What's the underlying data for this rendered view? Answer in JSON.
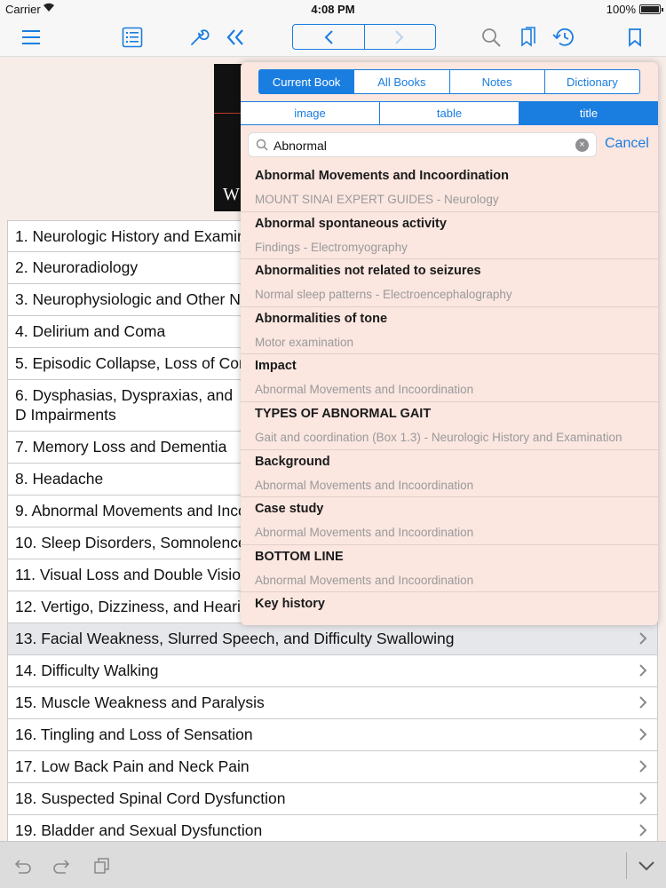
{
  "status_bar": {
    "carrier": "Carrier",
    "time": "4:08 PM",
    "battery": "100%"
  },
  "toolbar": {
    "icons": [
      "menu-icon",
      "list-icon",
      "wrench-icon",
      "double-chevron-left-icon",
      "back-icon",
      "forward-icon",
      "search-icon",
      "bookmarks-icon",
      "history-icon",
      "bookmark-icon"
    ],
    "accent": "#1a7de0"
  },
  "cover": {
    "visible_letter": "W"
  },
  "toc": {
    "items": [
      {
        "label": "1. Neurologic History and Examir"
      },
      {
        "label": "2. Neuroradiology"
      },
      {
        "label": "3. Neurophysiologic and Other N"
      },
      {
        "label": "4. Delirium and Coma"
      },
      {
        "label": "5. Episodic Collapse, Loss of Cor"
      },
      {
        "label": "6. Dysphasias, Dyspraxias, and D Impairments"
      },
      {
        "label": "7. Memory Loss and Dementia"
      },
      {
        "label": "8. Headache"
      },
      {
        "label": "9. Abnormal Movements and Inco"
      },
      {
        "label": "10. Sleep Disorders, Somnolence"
      },
      {
        "label": "11. Visual Loss and Double Visio"
      },
      {
        "label": "12. Vertigo, Dizziness, and Heari"
      },
      {
        "label": "13. Facial Weakness, Slurred Speech, and Difficulty Swallowing"
      },
      {
        "label": "14. Difficulty Walking"
      },
      {
        "label": "15. Muscle Weakness and Paralysis"
      },
      {
        "label": "16. Tingling and Loss of Sensation"
      },
      {
        "label": "17. Low Back Pain and Neck Pain"
      },
      {
        "label": "18. Suspected Spinal Cord Dysfunction"
      },
      {
        "label": "19. Bladder and Sexual Dysfunction"
      }
    ]
  },
  "search": {
    "scope_tabs": [
      {
        "label": "Current Book",
        "selected": true
      },
      {
        "label": "All Books",
        "selected": false
      },
      {
        "label": "Notes",
        "selected": false
      },
      {
        "label": "Dictionary",
        "selected": false
      }
    ],
    "type_tabs": [
      {
        "label": "image",
        "selected": false
      },
      {
        "label": "table",
        "selected": false
      },
      {
        "label": "title",
        "selected": true
      }
    ],
    "query": "Abnormal",
    "cancel_label": "Cancel",
    "results": [
      {
        "title": "Abnormal Movements and Incoordination",
        "subtitle": "MOUNT SINAI EXPERT GUIDES - Neurology"
      },
      {
        "title": "Abnormal spontaneous activity",
        "subtitle": "Findings - Electromyography"
      },
      {
        "title": "Abnormalities not related to seizures",
        "subtitle": "Normal sleep patterns - Electroencephalography"
      },
      {
        "title": "Abnormalities of tone",
        "subtitle": "Motor examination"
      },
      {
        "title": "Impact",
        "subtitle": "Abnormal Movements and Incoordination"
      },
      {
        "title": "TYPES OF ABNORMAL GAIT",
        "subtitle": "Gait and coordination (Box 1.3) - Neurologic History and Examination"
      },
      {
        "title": "Background",
        "subtitle": "Abnormal Movements and Incoordination"
      },
      {
        "title": "Case study",
        "subtitle": "Abnormal Movements and Incoordination"
      },
      {
        "title": "BOTTOM LINE",
        "subtitle": "Abnormal Movements and Incoordination"
      },
      {
        "title": "Key history",
        "subtitle": ""
      }
    ]
  },
  "bottom_bar": {
    "icons": [
      "undo-icon",
      "redo-icon",
      "copy-icon",
      "collapse-chevron-icon"
    ]
  }
}
